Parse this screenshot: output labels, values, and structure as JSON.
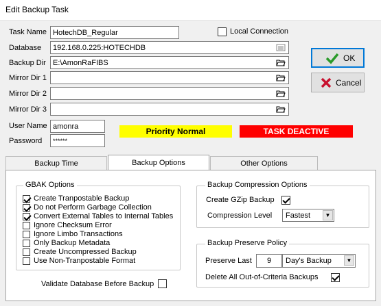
{
  "window": {
    "title": "Edit Backup Task"
  },
  "form": {
    "task_name_label": "Task Name",
    "task_name": "HotechDB_Regular",
    "database_label": "Database",
    "database": "192.168.0.225:HOTECHDB",
    "backup_dir_label": "Backup Dir",
    "backup_dir": "E:\\AmonRaFIBS",
    "mirror1_label": "Mirror Dir 1",
    "mirror1": "",
    "mirror2_label": "Mirror Dir 2",
    "mirror2": "",
    "mirror3_label": "Mirror Dir 3",
    "mirror3": "",
    "user_label": "User Name",
    "user": "amonra",
    "password_label": "Password",
    "password": "******",
    "local_connection_label": "Local Connection",
    "local_connection_checked": false
  },
  "buttons": {
    "ok": "OK",
    "cancel": "Cancel"
  },
  "status": {
    "priority": "Priority Normal",
    "priority_color": "#ffff00",
    "task": "TASK DEACTIVE",
    "task_color": "#ff0000"
  },
  "tabs": [
    {
      "label": "Backup Time",
      "active": false
    },
    {
      "label": "Backup Options",
      "active": true
    },
    {
      "label": "Other Options",
      "active": false
    }
  ],
  "gbak": {
    "title": "GBAK Options",
    "options": [
      {
        "label": "Create Tranpostable Backup",
        "checked": true
      },
      {
        "label": "Do not Perform Garbage Collection",
        "checked": true
      },
      {
        "label": "Convert External Tables to Internal Tables",
        "checked": true
      },
      {
        "label": "Ignore Checksum Error",
        "checked": false
      },
      {
        "label": "Ignore Limbo Transactions",
        "checked": false
      },
      {
        "label": "Only Backup Metadata",
        "checked": false
      },
      {
        "label": "Create Uncompressed Backup",
        "checked": false
      },
      {
        "label": "Use Non-Tranpostable Format",
        "checked": false
      }
    ]
  },
  "validate": {
    "label": "Validate Database Before Backup",
    "checked": false
  },
  "compression": {
    "title": "Backup Compression Options",
    "gzip_label": "Create GZip Backup",
    "gzip_checked": true,
    "level_label": "Compression Level",
    "level_value": "Fastest"
  },
  "preserve": {
    "title": "Backup Preserve Policy",
    "last_label": "Preserve Last",
    "last_value": "9",
    "unit_value": "Day's Backup",
    "delete_label": "Delete  All Out-of-Criteria Backups",
    "delete_checked": true
  }
}
